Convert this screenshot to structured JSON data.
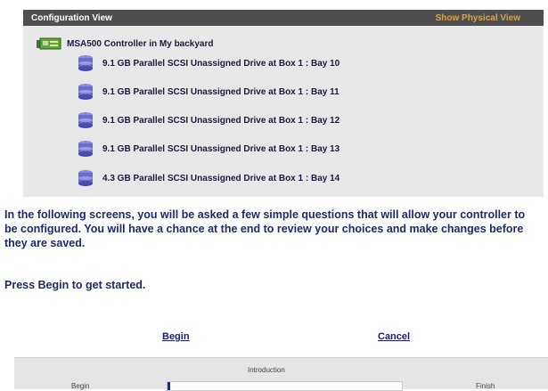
{
  "panel": {
    "title": "Configuration View",
    "physical_view_link": "Show Physical View",
    "controller_label": "MSA500 Controller in My backyard",
    "controller_icon": "controller-board-icon",
    "drive_icon": "disk-drive-icon",
    "drives": [
      "9.1 GB Parallel SCSI Unassigned Drive at Box 1 : Bay 10",
      "9.1 GB Parallel SCSI Unassigned Drive at Box 1 : Bay 11",
      "9.1 GB Parallel SCSI Unassigned Drive at Box 1 : Bay 12",
      "9.1 GB Parallel SCSI Unassigned Drive at Box 1 : Bay 13",
      "4.3 GB Parallel SCSI Unassigned Drive at Box 1 : Bay 14"
    ]
  },
  "intro_text": "In the following screens, you will be asked a few simple questions that will allow your controller to be configured. You will have a chance at the end to review your choices and make changes before they are saved.",
  "press_text": "Press Begin to get started.",
  "actions": {
    "begin": "Begin",
    "cancel": "Cancel"
  },
  "wizard": {
    "current_step": "Introduction",
    "start_label": "Begin",
    "end_label": "Finish",
    "progress_fraction": 0.01
  },
  "colors": {
    "header_bg": "#4f4f4f",
    "link_accent": "#d8a24a",
    "text": "#1d2a6a"
  }
}
